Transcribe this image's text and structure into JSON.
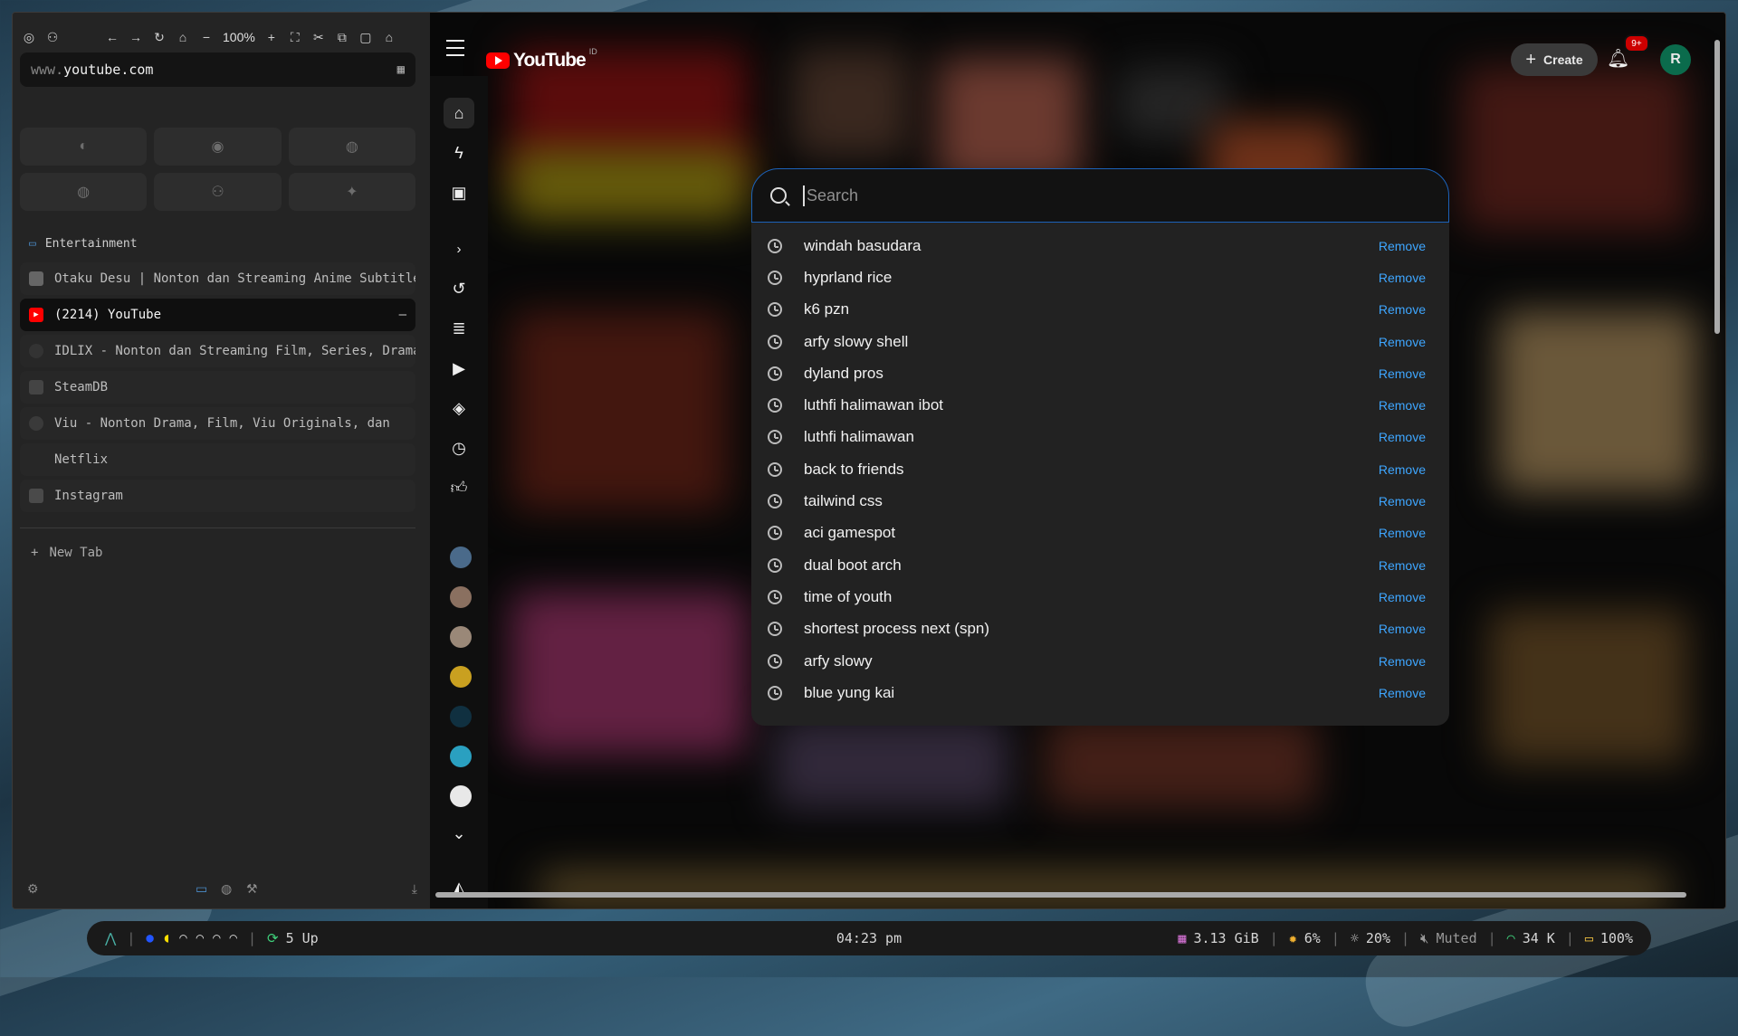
{
  "browser": {
    "zoom": "100%",
    "url_host_prefix": "www.",
    "url_domain": "youtube.com",
    "folder_label": "Entertainment",
    "tabs": [
      {
        "title": "Otaku Desu | Nonton dan Streaming Anime Subtitle"
      },
      {
        "title": "(2214) YouTube"
      },
      {
        "title": "IDLIX - Nonton dan Streaming Film, Series, Drama"
      },
      {
        "title": "SteamDB"
      },
      {
        "title": "Viu - Nonton Drama, Film, Viu Originals, dan"
      },
      {
        "title": "Netflix"
      },
      {
        "title": "Instagram"
      }
    ],
    "new_tab_label": "New Tab",
    "close_tab_symbol": "—"
  },
  "youtube": {
    "logo_text": "YouTube",
    "country_code": "ID",
    "create_label": "Create",
    "notif_badge": "9+",
    "avatar_letter": "R",
    "search_placeholder": "Search",
    "remove_label": "Remove",
    "suggestions": [
      "windah basudara",
      "hyprland rice",
      "k6 pzn",
      "arfy slowy shell",
      "dyland pros",
      "luthfi halimawan ibot",
      "luthfi halimawan",
      "back to friends",
      "tailwind css",
      "aci gamespot",
      "dual boot arch",
      "time of youth",
      "shortest process next (spn)",
      "arfy slowy",
      "blue yung kai"
    ],
    "accent_color": "#3ea6ff",
    "brand_color": "#ff0000"
  },
  "taskbar": {
    "updates": "5 Up",
    "clock": "04:23 pm",
    "memory": "3.13 GiB",
    "cpu": "6%",
    "brightness": "20%",
    "volume": "Muted",
    "network": "34 K",
    "battery": "100%"
  }
}
